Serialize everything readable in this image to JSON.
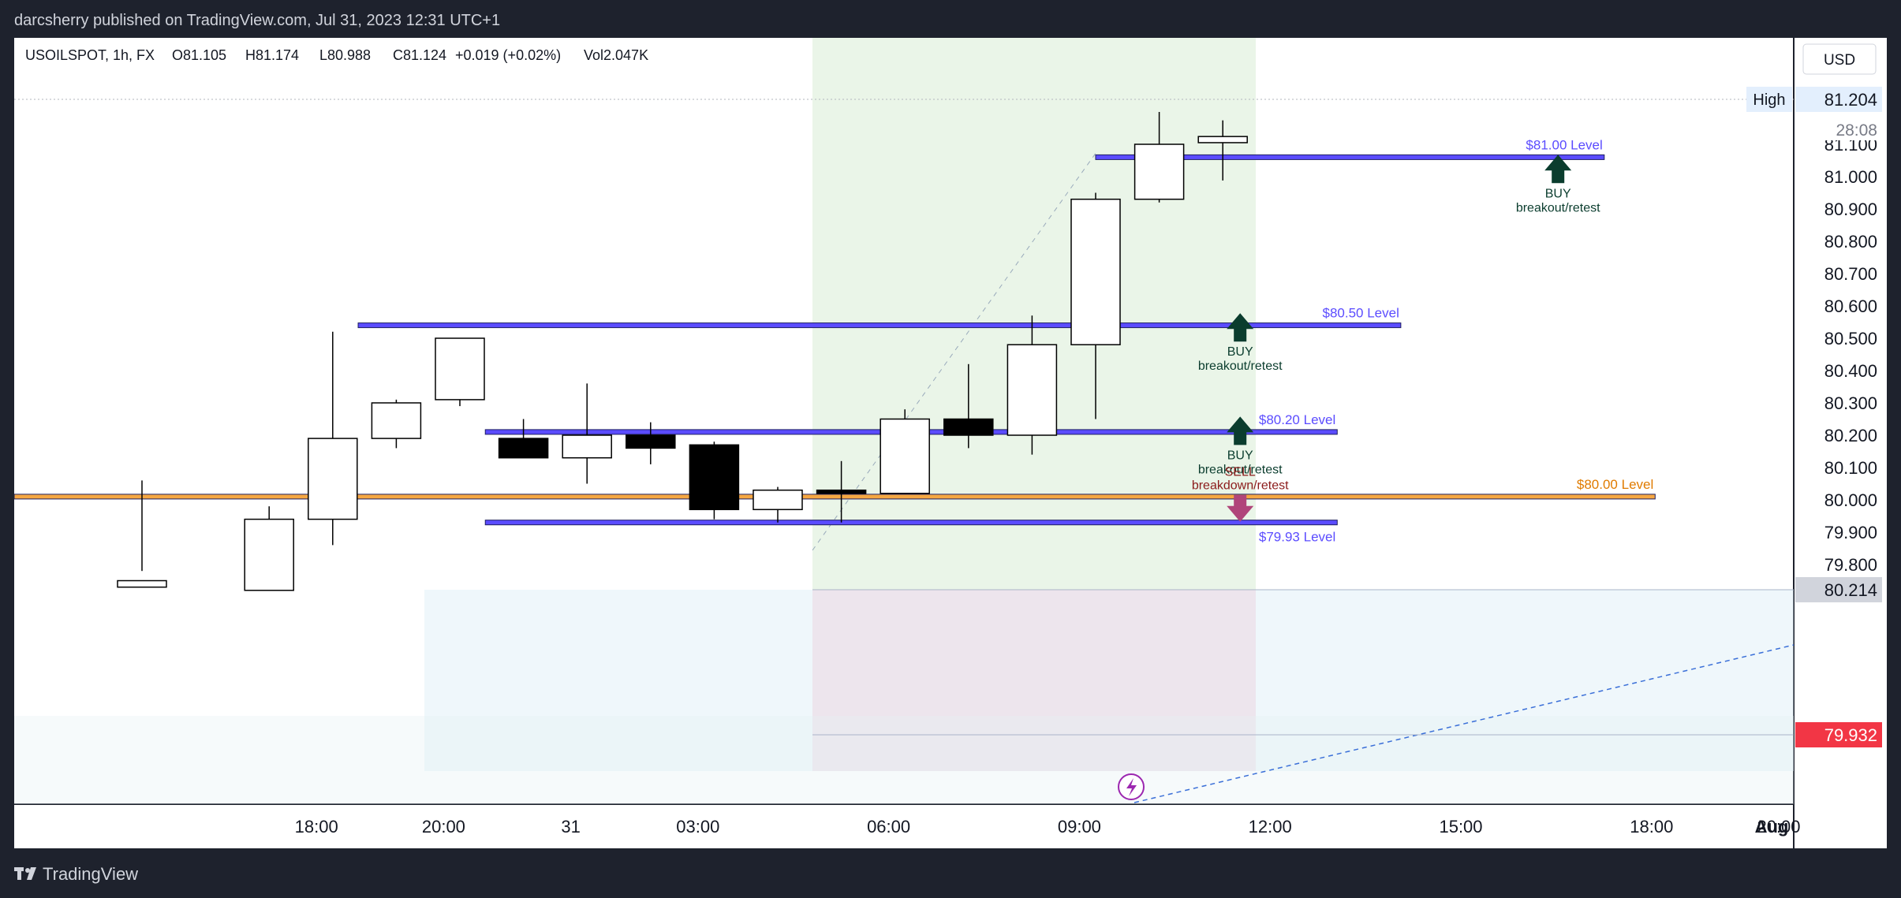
{
  "header": {
    "publisher": "darcsherry published on TradingView.com, Jul 31, 2023 12:31 UTC+1"
  },
  "legend": {
    "symbol": "USOILSPOT, 1h, FX",
    "open": "O81.105",
    "high": "H81.174",
    "low": "L80.988",
    "close": "C81.124",
    "change": "+0.019 (+0.02%)",
    "volume": "Vol2.047K"
  },
  "currency": "USD",
  "price_labels": {
    "high_tag": "High",
    "high_value": "81.204",
    "countdown": "28:08",
    "last_level": "80.214",
    "current": "79.932"
  },
  "footer": {
    "brand": "TradingView"
  },
  "colors": {
    "bull": "#ffffff",
    "bear": "#000000",
    "level_line": "#5b4cff",
    "orange_line": "#f5a742",
    "buy_arrow": "#0b3d2e",
    "sell_arrow": "#b0457a",
    "current_price_bg": "#f23645"
  },
  "chart_data": {
    "type": "candlestick",
    "symbol": "USOILSPOT",
    "timeframe": "1h",
    "y_axis": {
      "min": 79.8,
      "max": 81.2,
      "ticks": [
        "81.100",
        "81.000",
        "80.900",
        "80.800",
        "80.700",
        "80.600",
        "80.500",
        "80.400",
        "80.300",
        "80.200",
        "80.100",
        "80.000",
        "79.900",
        "79.800"
      ]
    },
    "x_ticks": [
      {
        "label": "18:00",
        "i": 2
      },
      {
        "label": "20:00",
        "i": 4
      },
      {
        "label": "31",
        "i": 6
      },
      {
        "label": "03:00",
        "i": 8
      },
      {
        "label": "06:00",
        "i": 11
      },
      {
        "label": "09:00",
        "i": 14
      },
      {
        "label": "12:00",
        "i": 17
      },
      {
        "label": "15:00",
        "i": 20
      },
      {
        "label": "18:00",
        "i": 23
      },
      {
        "label": "20:00",
        "i": 25
      },
      {
        "label": "Aug",
        "i": 27
      }
    ],
    "candles": [
      {
        "i": 0,
        "o": 79.73,
        "h": 80.06,
        "l": 79.78,
        "c": 79.75
      },
      {
        "i": 2,
        "o": 79.72,
        "h": 79.98,
        "l": 79.75,
        "c": 79.94
      },
      {
        "i": 3,
        "o": 79.94,
        "h": 80.52,
        "l": 79.86,
        "c": 80.19
      },
      {
        "i": 4,
        "o": 80.19,
        "h": 80.31,
        "l": 80.16,
        "c": 80.3
      },
      {
        "i": 5,
        "o": 80.31,
        "h": 80.5,
        "l": 80.29,
        "c": 80.5
      },
      {
        "i": 6,
        "o": 80.19,
        "h": 80.25,
        "l": 80.13,
        "c": 80.13
      },
      {
        "i": 7,
        "o": 80.13,
        "h": 80.36,
        "l": 80.05,
        "c": 80.2
      },
      {
        "i": 8,
        "o": 80.2,
        "h": 80.24,
        "l": 80.11,
        "c": 80.16
      },
      {
        "i": 9,
        "o": 80.17,
        "h": 80.18,
        "l": 79.94,
        "c": 79.97
      },
      {
        "i": 10,
        "o": 79.97,
        "h": 80.04,
        "l": 79.93,
        "c": 80.03
      },
      {
        "i": 11,
        "o": 80.03,
        "h": 80.12,
        "l": 79.93,
        "c": 80.02
      },
      {
        "i": 12,
        "o": 80.02,
        "h": 80.28,
        "l": 80.02,
        "c": 80.25
      },
      {
        "i": 13,
        "o": 80.25,
        "h": 80.42,
        "l": 80.16,
        "c": 80.2
      },
      {
        "i": 14,
        "o": 80.2,
        "h": 80.57,
        "l": 80.14,
        "c": 80.48
      },
      {
        "i": 15,
        "o": 80.48,
        "h": 80.95,
        "l": 80.25,
        "c": 80.93
      },
      {
        "i": 16,
        "o": 80.93,
        "h": 81.2,
        "l": 80.92,
        "c": 81.1
      },
      {
        "i": 17,
        "o": 81.105,
        "h": 81.174,
        "l": 80.988,
        "c": 81.124
      }
    ],
    "levels": [
      {
        "label": "$81.00 Level",
        "price": 81.06,
        "from": 15.0,
        "to": 23.0,
        "color": "#5b4cff"
      },
      {
        "label": "$80.50 Level",
        "price": 80.54,
        "from": 3.4,
        "to": 19.8,
        "color": "#5b4cff"
      },
      {
        "label": "$80.20 Level",
        "price": 80.21,
        "from": 5.4,
        "to": 18.8,
        "color": "#5b4cff"
      },
      {
        "label": "$80.00 Level",
        "price": 80.01,
        "from": -1,
        "to": 23.8,
        "color": "#f5a742"
      },
      {
        "label": "$79.93 Level",
        "price": 79.93,
        "from": 5.4,
        "to": 18.8,
        "color": "#5b4cff"
      }
    ],
    "annotations": [
      {
        "type": "buy",
        "title": "BUY",
        "text": "breakout/retest",
        "i": 22,
        "price": 80.97
      },
      {
        "type": "buy",
        "title": "BUY",
        "text": "breakout/retest",
        "i": 17,
        "price": 80.48
      },
      {
        "type": "buy",
        "title": "BUY",
        "text": "breakout/retest",
        "i": 17,
        "price": 80.16
      },
      {
        "type": "sell",
        "title": "SELL",
        "text": "breakdown/retest",
        "i": 17,
        "price": 80.03
      }
    ]
  }
}
